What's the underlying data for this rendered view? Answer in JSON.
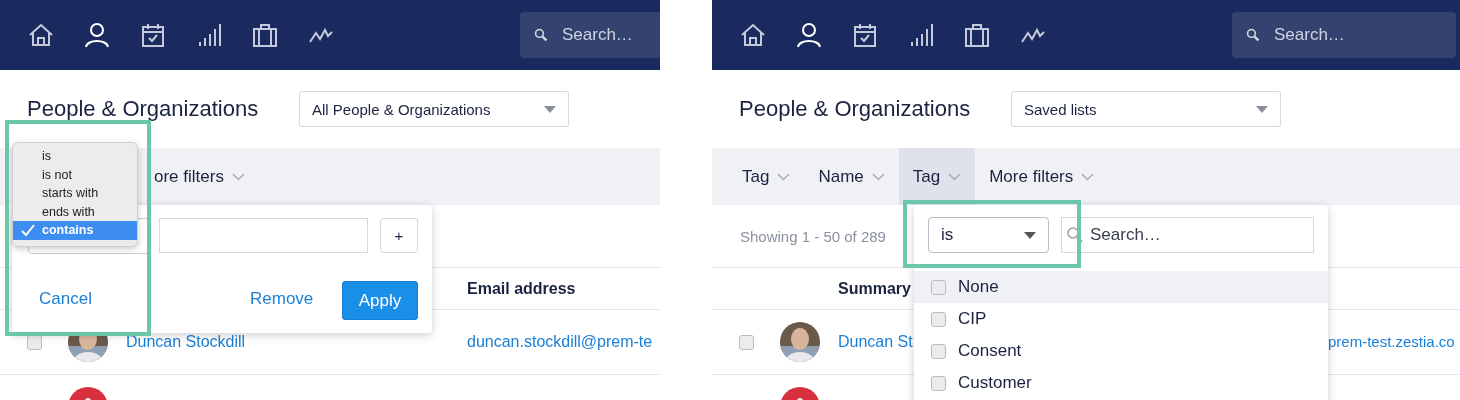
{
  "panels": [
    {
      "nav": [
        {
          "selected": false
        },
        {
          "selected": true
        },
        {
          "selected": false
        },
        {
          "selected": false
        },
        {
          "selected": false
        },
        {
          "selected": false
        }
      ],
      "search": {
        "placeholder": "Search…"
      },
      "title": "People & Organizations",
      "view_select": {
        "value": "All People & Organizations"
      },
      "filters": [
        {
          "label": "ore filters",
          "selected": false
        }
      ],
      "email_header": "Email address",
      "rows": [
        {
          "checked": false,
          "avatar": {
            "kind": "picture"
          },
          "name": "Duncan Stockdill",
          "email": "duncan.stockdill@prem-te"
        },
        {
          "avatar": {
            "kind": "picture"
          }
        }
      ],
      "popup": {
        "kind": "text_filter",
        "operator_menu": [
          {
            "label": "is",
            "selected": false
          },
          {
            "label": "is not",
            "selected": false
          },
          {
            "label": "starts with",
            "selected": false
          },
          {
            "label": "ends with",
            "selected": false
          },
          {
            "label": "contains",
            "selected": true
          }
        ],
        "add_button": "+",
        "cancel": "Cancel",
        "remove": "Remove",
        "apply": "Apply"
      }
    },
    {
      "nav": [
        {
          "selected": false
        },
        {
          "selected": true
        },
        {
          "selected": false
        },
        {
          "selected": false
        },
        {
          "selected": false
        },
        {
          "selected": false
        }
      ],
      "search": {
        "placeholder": "Search…"
      },
      "title": "People & Organizations",
      "view_select": {
        "value": "Saved lists"
      },
      "filters": [
        {
          "label": "Tag",
          "selected": false
        },
        {
          "label": "Name",
          "selected": false
        },
        {
          "label": "Tag",
          "selected": true
        },
        {
          "label": "More filters",
          "selected": false
        }
      ],
      "status": "Showing 1 - 50 of 289",
      "name_header": "Summary",
      "rows": [
        {
          "checked": false,
          "avatar": {
            "kind": "picture"
          },
          "name": "Duncan St",
          "email": "prem-test.zestia.co"
        },
        {
          "avatar": {
            "kind": "picture"
          }
        }
      ],
      "popup": {
        "kind": "tag_filter",
        "operator": "is",
        "search_placeholder": "Search…",
        "options": [
          {
            "label": "None",
            "checked": false,
            "highlighted": true
          },
          {
            "label": "CIP",
            "checked": false,
            "highlighted": false
          },
          {
            "label": "Consent",
            "checked": false,
            "highlighted": false
          },
          {
            "label": "Customer",
            "checked": false,
            "highlighted": false
          }
        ]
      }
    }
  ]
}
